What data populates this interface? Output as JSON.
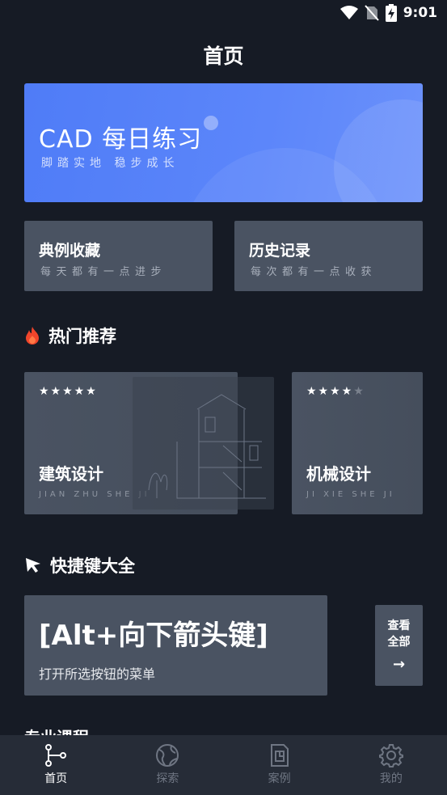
{
  "status": {
    "time": "9:01"
  },
  "page": {
    "title": "首页"
  },
  "banner": {
    "title": "CAD 每日练习",
    "subtitle": "脚踏实地 稳步成长"
  },
  "cards": [
    {
      "title": "典例收藏",
      "subtitle": "每天都有一点进步"
    },
    {
      "title": "历史记录",
      "subtitle": "每次都有一点收获"
    }
  ],
  "hot": {
    "heading": "热门推荐",
    "items": [
      {
        "title": "建筑设计",
        "subtitle": "JIAN ZHU SHE JI",
        "rating": 5
      },
      {
        "title": "机械设计",
        "subtitle": "JI XIE SHE JI",
        "rating": 4
      }
    ]
  },
  "shortcuts": {
    "heading": "快捷键大全",
    "key": "[Alt+向下箭头键]",
    "description": "打开所选按钮的菜单",
    "view_all_line1": "查看",
    "view_all_line2": "全部",
    "view_all_arrow": "→"
  },
  "next_section_peek": "专业课程",
  "nav": [
    {
      "label": "首页",
      "icon": "graph-nodes-icon",
      "active": true
    },
    {
      "label": "探索",
      "icon": "globe-icon",
      "active": false
    },
    {
      "label": "案例",
      "icon": "blueprint-icon",
      "active": false
    },
    {
      "label": "我的",
      "icon": "gear-icon",
      "active": false
    }
  ],
  "colors": {
    "accent_blue": "#5781f8",
    "card": "#4a5362",
    "background": "#161b25",
    "fire": "#f0452b"
  }
}
